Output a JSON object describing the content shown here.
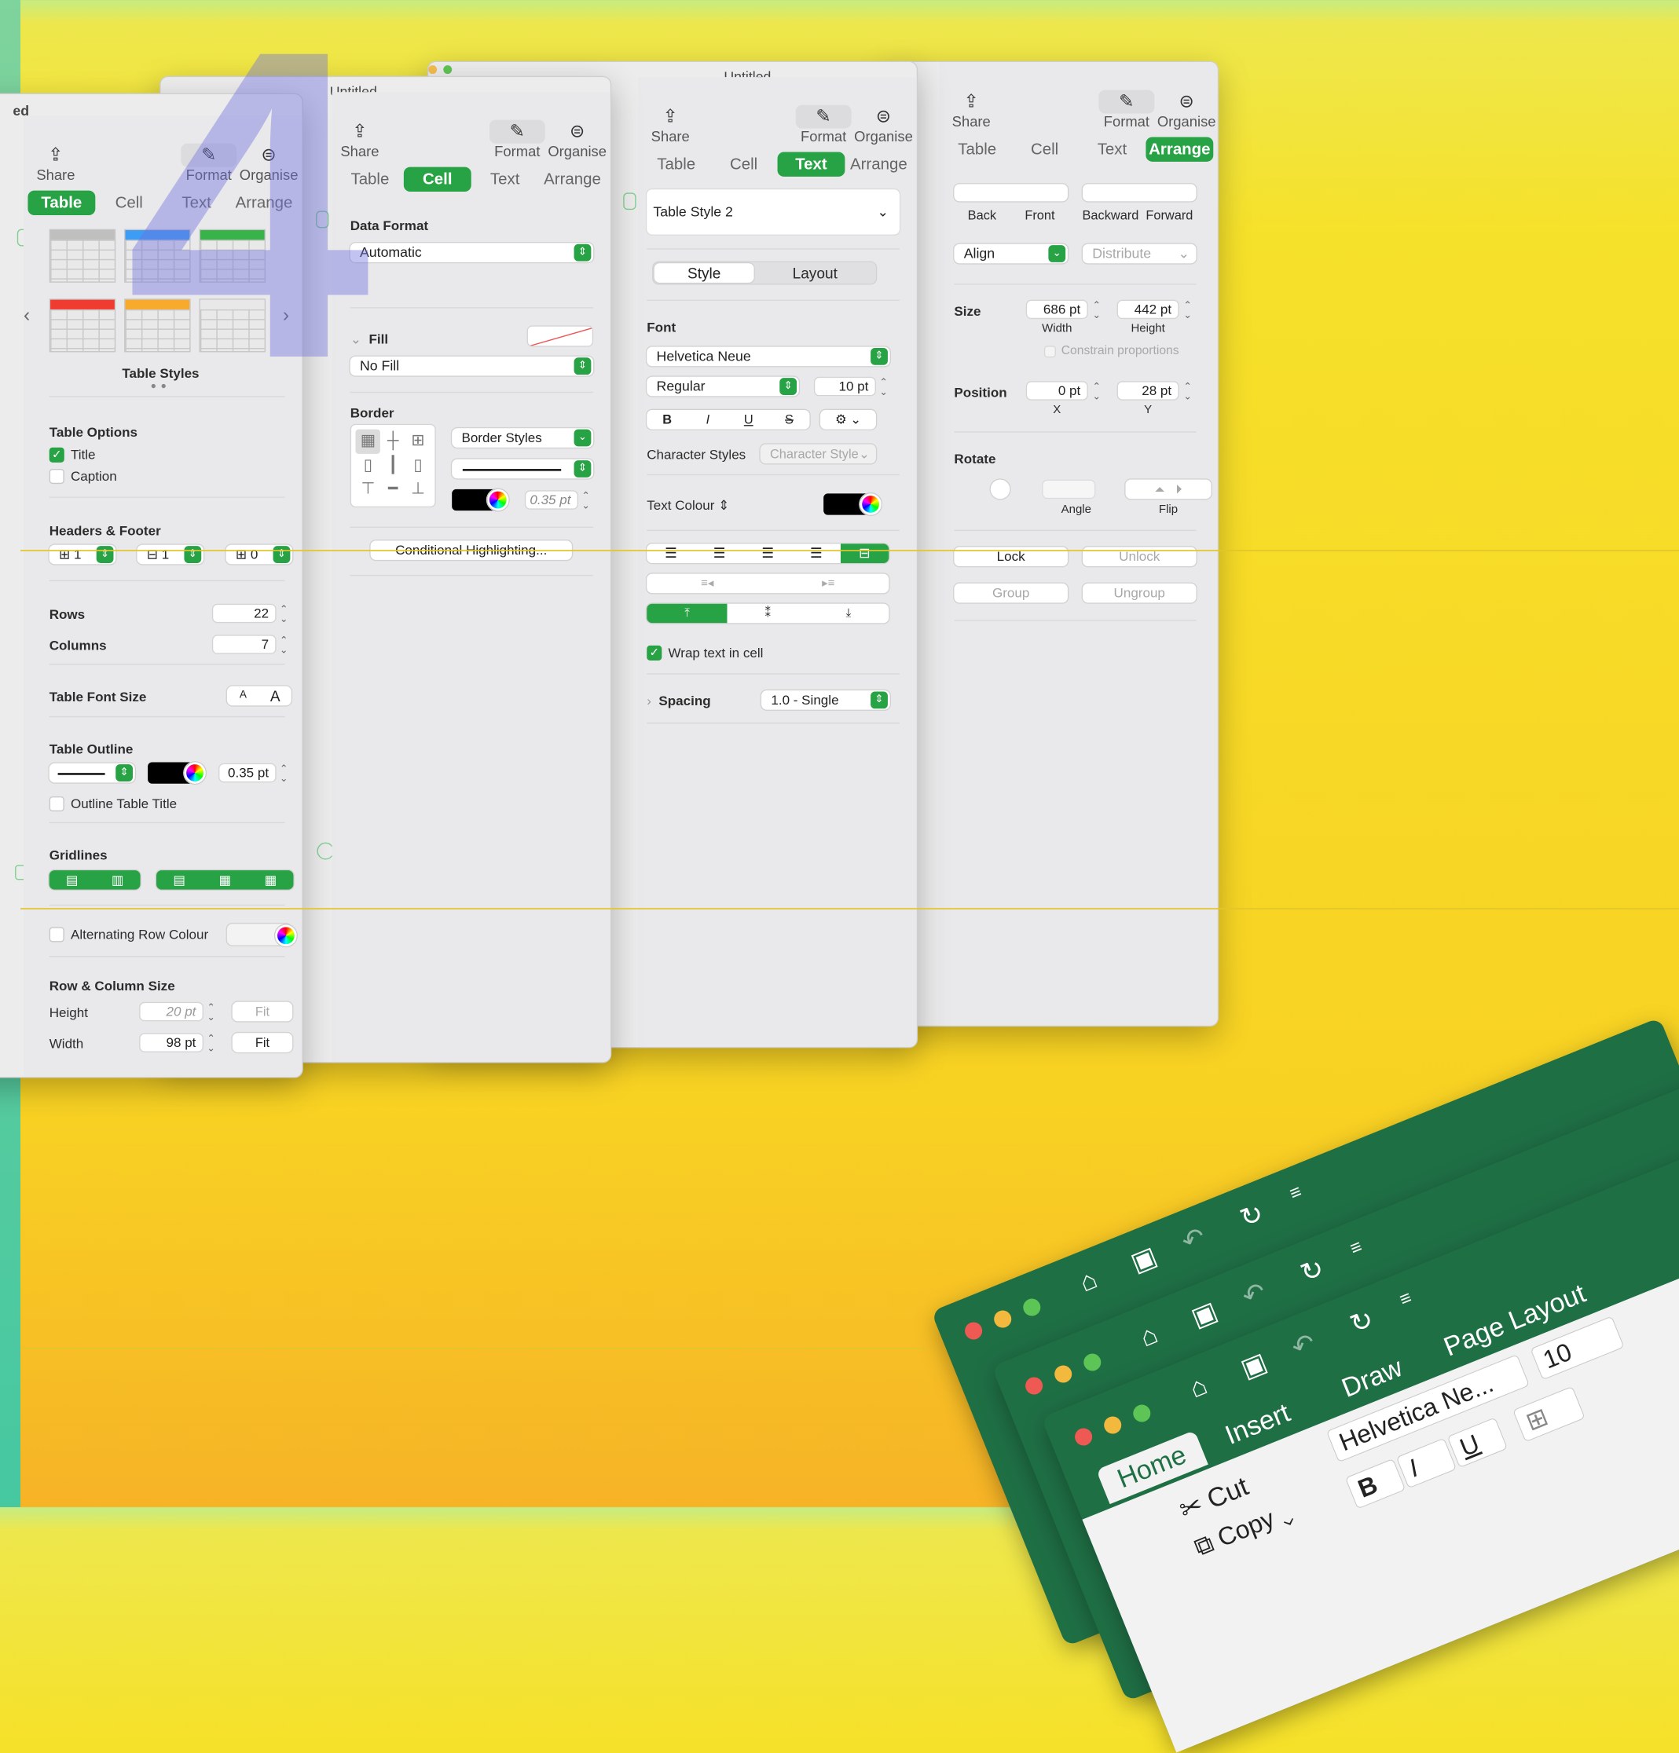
{
  "overlay_number": "4",
  "windows": {
    "title_front": "Untitled",
    "title_back": "Untitled",
    "title_partial": "ed"
  },
  "toolbar": {
    "share": "Share",
    "format": "Format",
    "organise": "Organise"
  },
  "tabs": {
    "table": "Table",
    "cell": "Cell",
    "text": "Text",
    "arrange": "Arrange"
  },
  "table_panel": {
    "styles_label": "Table Styles",
    "style_colors": [
      "#bfbfbf",
      "#3d9df5",
      "#37b34a",
      "#f03b30",
      "#f7aa2b",
      "#e8e8e8"
    ],
    "options_title": "Table Options",
    "title_label": "Title",
    "caption_label": "Caption",
    "headers_title": "Headers & Footer",
    "header_rows": "1",
    "header_cols": "1",
    "footer_rows": "0",
    "rows_label": "Rows",
    "rows_value": "22",
    "columns_label": "Columns",
    "columns_value": "7",
    "font_size_label": "Table Font Size",
    "font_small": "A",
    "font_large": "A",
    "outline_title": "Table Outline",
    "outline_width": "0.35 pt",
    "outline_title_label": "Outline Table Title",
    "gridlines_title": "Gridlines",
    "alt_row_label": "Alternating Row Colour",
    "row_col_title": "Row & Column Size",
    "height_label": "Height",
    "height_value": "20 pt",
    "width_label": "Width",
    "width_value": "98 pt",
    "fit": "Fit"
  },
  "cell_panel": {
    "data_format_title": "Data Format",
    "data_format_value": "Automatic",
    "fill_title": "Fill",
    "fill_value": "No Fill",
    "border_title": "Border",
    "border_styles": "Border Styles",
    "border_width": "0.35 pt",
    "conditional": "Conditional Highlighting..."
  },
  "text_panel": {
    "paragraph_style": "Table Style 2",
    "seg_style": "Style",
    "seg_layout": "Layout",
    "font_title": "Font",
    "font_name": "Helvetica Neue",
    "font_weight": "Regular",
    "font_size": "10 pt",
    "bold": "B",
    "italic": "I",
    "underline": "U",
    "strike": "S",
    "char_styles_label": "Character Styles",
    "char_style_value": "Character Style",
    "text_colour_label": "Text Colour",
    "wrap_label": "Wrap text in cell",
    "spacing_label": "Spacing",
    "spacing_value": "1.0 - Single"
  },
  "arrange_panel": {
    "back": "Back",
    "front": "Front",
    "backward": "Backward",
    "forward": "Forward",
    "align": "Align",
    "distribute": "Distribute",
    "size_label": "Size",
    "width_value": "686 pt",
    "width_label": "Width",
    "height_value": "442 pt",
    "height_label": "Height",
    "constrain": "Constrain proportions",
    "position_label": "Position",
    "x_value": "0 pt",
    "x_label": "X",
    "y_value": "28 pt",
    "y_label": "Y",
    "rotate_label": "Rotate",
    "angle_label": "Angle",
    "flip_label": "Flip",
    "lock": "Lock",
    "unlock": "Unlock",
    "group": "Group",
    "ungroup": "Ungroup"
  },
  "excel": {
    "tab_home": "Home",
    "tab_insert": "Insert",
    "tab_draw": "Draw",
    "tab_page_layout": "Page Layout",
    "font_name": "Helvetica Ne...",
    "font_size": "10",
    "cut": "Cut",
    "copy": "Copy",
    "bold": "B",
    "italic": "I",
    "underline": "U"
  }
}
